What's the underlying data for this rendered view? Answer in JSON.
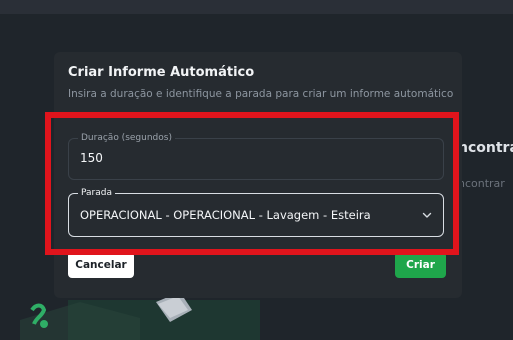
{
  "background": {
    "heading_partial": "ncontra",
    "subheading_partial": "ncontrar"
  },
  "modal": {
    "title": "Criar Informe Automático",
    "subtitle": "Insira a duração e identifique a parada para criar um informe automático",
    "duration_field": {
      "label": "Duração (segundos)",
      "value": "150"
    },
    "parada_field": {
      "label": "Parada",
      "value": "OPERACIONAL - OPERACIONAL - Lavagem - Esteira",
      "icon": "chevron-down-icon"
    },
    "cancel_label": "Cancelar",
    "create_label": "Criar"
  },
  "colors": {
    "accent_green": "#1fa64b",
    "highlight_red": "#e0141c",
    "modal_bg": "#262b30"
  }
}
